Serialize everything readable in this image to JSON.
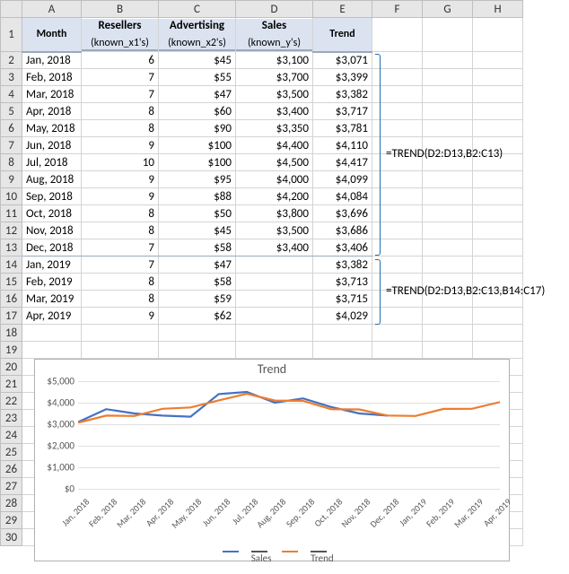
{
  "columns": [
    "A",
    "B",
    "C",
    "D",
    "E",
    "F",
    "G",
    "H"
  ],
  "row_numbers": [
    1,
    2,
    3,
    4,
    5,
    6,
    7,
    8,
    9,
    10,
    11,
    12,
    13,
    14,
    15,
    16,
    17,
    18,
    19,
    20,
    21,
    22,
    23,
    24,
    25,
    26,
    27,
    28,
    29,
    30
  ],
  "headers": {
    "A_top": "Month",
    "A_bot": "",
    "B_top": "Resellers",
    "B_bot": "(known_x1's)",
    "C_top": "Advertising",
    "C_bot": "(known_x2's)",
    "D_top": "Sales",
    "D_bot": "(known_y's)",
    "E_top": "Trend",
    "E_bot": ""
  },
  "data": [
    {
      "month": "Jan, 2018",
      "resellers": "6",
      "adv": "$45",
      "sales": "$3,100",
      "trend": "$3,071"
    },
    {
      "month": "Feb, 2018",
      "resellers": "7",
      "adv": "$55",
      "sales": "$3,700",
      "trend": "$3,399"
    },
    {
      "month": "Mar, 2018",
      "resellers": "7",
      "adv": "$47",
      "sales": "$3,500",
      "trend": "$3,382"
    },
    {
      "month": "Apr, 2018",
      "resellers": "8",
      "adv": "$60",
      "sales": "$3,400",
      "trend": "$3,717"
    },
    {
      "month": "May, 2018",
      "resellers": "8",
      "adv": "$90",
      "sales": "$3,350",
      "trend": "$3,781"
    },
    {
      "month": "Jun, 2018",
      "resellers": "9",
      "adv": "$100",
      "sales": "$4,400",
      "trend": "$4,110"
    },
    {
      "month": "Jul, 2018",
      "resellers": "10",
      "adv": "$100",
      "sales": "$4,500",
      "trend": "$4,417"
    },
    {
      "month": "Aug, 2018",
      "resellers": "9",
      "adv": "$95",
      "sales": "$4,000",
      "trend": "$4,099"
    },
    {
      "month": "Sep, 2018",
      "resellers": "9",
      "adv": "$88",
      "sales": "$4,200",
      "trend": "$4,084"
    },
    {
      "month": "Oct, 2018",
      "resellers": "8",
      "adv": "$50",
      "sales": "$3,800",
      "trend": "$3,696"
    },
    {
      "month": "Nov, 2018",
      "resellers": "8",
      "adv": "$45",
      "sales": "$3,500",
      "trend": "$3,686"
    },
    {
      "month": "Dec, 2018",
      "resellers": "7",
      "adv": "$58",
      "sales": "$3,400",
      "trend": "$3,406"
    },
    {
      "month": "Jan, 2019",
      "resellers": "7",
      "adv": "$47",
      "sales": "",
      "trend": "$3,382"
    },
    {
      "month": "Feb, 2019",
      "resellers": "8",
      "adv": "$58",
      "sales": "",
      "trend": "$3,713"
    },
    {
      "month": "Mar, 2019",
      "resellers": "8",
      "adv": "$59",
      "sales": "",
      "trend": "$3,715"
    },
    {
      "month": "Apr, 2019",
      "resellers": "9",
      "adv": "$62",
      "sales": "",
      "trend": "$4,029"
    }
  ],
  "formulas": {
    "f1": "=TREND(D2:D13,B2:C13)",
    "f2": "=TREND(D2:D13,B2:C13,B14:C17)"
  },
  "chart": {
    "title": "Trend",
    "yticks": [
      "$0",
      "$1,000",
      "$2,000",
      "$3,000",
      "$4,000",
      "$5,000"
    ],
    "legend": {
      "s1": "Sales",
      "s2": "Trend"
    },
    "colors": {
      "sales": "#4472c4",
      "trend": "#ed7d31"
    }
  },
  "chart_data": {
    "type": "line",
    "title": "Trend",
    "ylabel": "",
    "xlabel": "",
    "ylim": [
      0,
      5000
    ],
    "categories": [
      "Jan, 2018",
      "Feb, 2018",
      "Mar, 2018",
      "Apr, 2018",
      "May, 2018",
      "Jun, 2018",
      "Jul, 2018",
      "Aug, 2018",
      "Sep, 2018",
      "Oct, 2018",
      "Nov, 2018",
      "Dec, 2018",
      "Jan, 2019",
      "Feb, 2019",
      "Mar, 2019",
      "Apr, 2019"
    ],
    "series": [
      {
        "name": "Sales",
        "color": "#4472c4",
        "values": [
          3100,
          3700,
          3500,
          3400,
          3350,
          4400,
          4500,
          4000,
          4200,
          3800,
          3500,
          3400,
          null,
          null,
          null,
          null
        ]
      },
      {
        "name": "Trend",
        "color": "#ed7d31",
        "values": [
          3071,
          3399,
          3382,
          3717,
          3781,
          4110,
          4417,
          4099,
          4084,
          3696,
          3686,
          3406,
          3382,
          3713,
          3715,
          4029
        ]
      }
    ]
  }
}
